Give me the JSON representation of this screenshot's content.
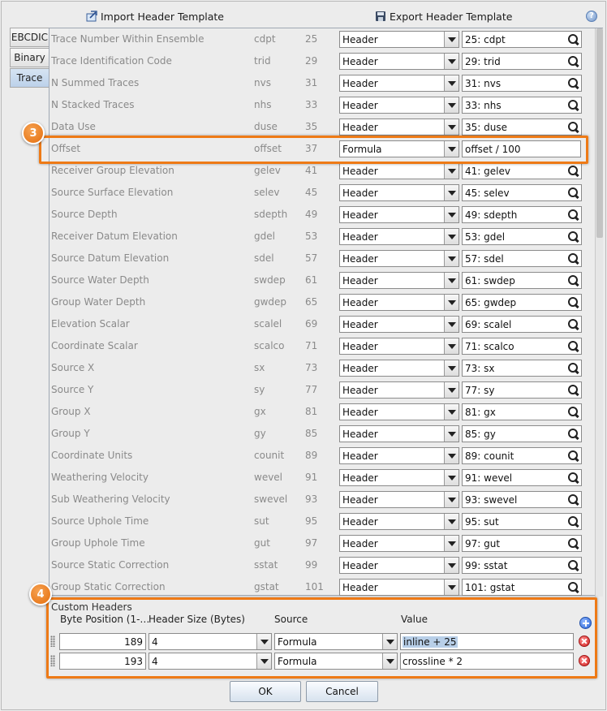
{
  "toolbar": {
    "import_label": "Import Header Template",
    "export_label": "Export Header Template"
  },
  "tabs": [
    {
      "label": "EBCDIC",
      "active": false
    },
    {
      "label": "Binary",
      "active": false
    },
    {
      "label": "Trace",
      "active": true
    }
  ],
  "rows": [
    {
      "name": "Trace Number Within Ensemble",
      "abbr": "cdpt",
      "pos": "25",
      "source": "Header",
      "value": "25: cdpt"
    },
    {
      "name": "Trace Identification Code",
      "abbr": "trid",
      "pos": "29",
      "source": "Header",
      "value": "29: trid"
    },
    {
      "name": "N Summed Traces",
      "abbr": "nvs",
      "pos": "31",
      "source": "Header",
      "value": "31: nvs"
    },
    {
      "name": "N Stacked Traces",
      "abbr": "nhs",
      "pos": "33",
      "source": "Header",
      "value": "33: nhs"
    },
    {
      "name": "Data Use",
      "abbr": "duse",
      "pos": "35",
      "source": "Header",
      "value": "35: duse"
    },
    {
      "name": "Offset",
      "abbr": "offset",
      "pos": "37",
      "source": "Formula",
      "value": "offset / 100",
      "formula": true
    },
    {
      "name": "Receiver Group Elevation",
      "abbr": "gelev",
      "pos": "41",
      "source": "Header",
      "value": "41: gelev"
    },
    {
      "name": "Source Surface Elevation",
      "abbr": "selev",
      "pos": "45",
      "source": "Header",
      "value": "45: selev"
    },
    {
      "name": "Source Depth",
      "abbr": "sdepth",
      "pos": "49",
      "source": "Header",
      "value": "49: sdepth"
    },
    {
      "name": "Receiver Datum Elevation",
      "abbr": "gdel",
      "pos": "53",
      "source": "Header",
      "value": "53: gdel"
    },
    {
      "name": "Source Datum Elevation",
      "abbr": "sdel",
      "pos": "57",
      "source": "Header",
      "value": "57: sdel"
    },
    {
      "name": "Source Water Depth",
      "abbr": "swdep",
      "pos": "61",
      "source": "Header",
      "value": "61: swdep"
    },
    {
      "name": "Group Water Depth",
      "abbr": "gwdep",
      "pos": "65",
      "source": "Header",
      "value": "65: gwdep"
    },
    {
      "name": "Elevation Scalar",
      "abbr": "scalel",
      "pos": "69",
      "source": "Header",
      "value": "69: scalel"
    },
    {
      "name": "Coordinate Scalar",
      "abbr": "scalco",
      "pos": "71",
      "source": "Header",
      "value": "71: scalco"
    },
    {
      "name": "Source X",
      "abbr": "sx",
      "pos": "73",
      "source": "Header",
      "value": "73: sx"
    },
    {
      "name": "Source Y",
      "abbr": "sy",
      "pos": "77",
      "source": "Header",
      "value": "77: sy"
    },
    {
      "name": "Group X",
      "abbr": "gx",
      "pos": "81",
      "source": "Header",
      "value": "81: gx"
    },
    {
      "name": "Group Y",
      "abbr": "gy",
      "pos": "85",
      "source": "Header",
      "value": "85: gy"
    },
    {
      "name": "Coordinate Units",
      "abbr": "counit",
      "pos": "89",
      "source": "Header",
      "value": "89: counit"
    },
    {
      "name": "Weathering Velocity",
      "abbr": "wevel",
      "pos": "91",
      "source": "Header",
      "value": "91: wevel"
    },
    {
      "name": "Sub Weathering Velocity",
      "abbr": "swevel",
      "pos": "93",
      "source": "Header",
      "value": "93: swevel"
    },
    {
      "name": "Source Uphole Time",
      "abbr": "sut",
      "pos": "95",
      "source": "Header",
      "value": "95: sut"
    },
    {
      "name": "Group Uphole Time",
      "abbr": "gut",
      "pos": "97",
      "source": "Header",
      "value": "97: gut"
    },
    {
      "name": "Source Static Correction",
      "abbr": "sstat",
      "pos": "99",
      "source": "Header",
      "value": "99: sstat"
    },
    {
      "name": "Group Static Correction",
      "abbr": "gstat",
      "pos": "101",
      "source": "Header",
      "value": "101: gstat"
    }
  ],
  "annotations": {
    "badge_3": "3",
    "badge_4": "4"
  },
  "custom": {
    "title": "Custom Headers",
    "columns": {
      "byte_position": "Byte Position (1-…",
      "header_size": "Header Size (Bytes)",
      "source": "Source",
      "value": "Value"
    },
    "rows": [
      {
        "byte_position": "189",
        "header_size": "4",
        "source": "Formula",
        "value": "inline + 25",
        "selected": true
      },
      {
        "byte_position": "193",
        "header_size": "4",
        "source": "Formula",
        "value": "crossline * 2",
        "selected": false
      }
    ]
  },
  "buttons": {
    "ok": "OK",
    "cancel": "Cancel"
  },
  "colors": {
    "highlight": "#ee7a16",
    "selection": "#b8cfe8"
  }
}
